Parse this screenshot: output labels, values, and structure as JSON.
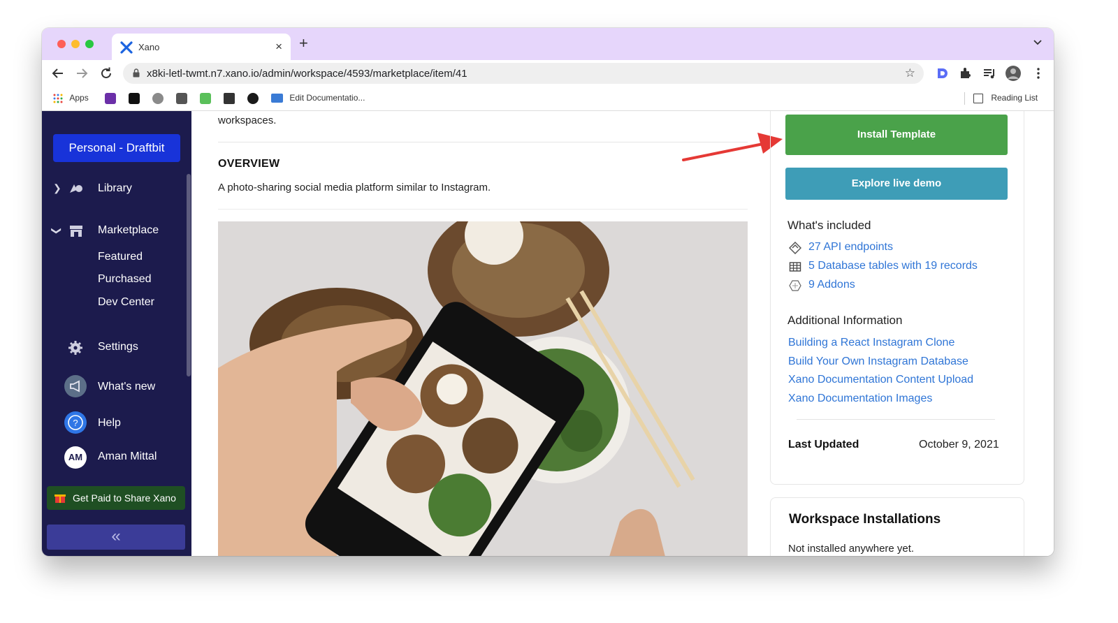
{
  "browser": {
    "tab_title": "Xano",
    "new_tab_glyph": "+",
    "close_glyph": "×",
    "url": "x8ki-letl-twmt.n7.xano.io/admin/workspace/4593/marketplace/item/41",
    "bookmarks": {
      "apps_label": "Apps",
      "edit_doc_label": "Edit Documentatio...",
      "reading_list_label": "Reading List"
    },
    "icons": [
      "back-icon",
      "forward-icon",
      "reload-icon",
      "lock-icon",
      "star-icon",
      "extension-icon",
      "puzzle-icon",
      "media-icon",
      "profile-icon",
      "menu-icon"
    ]
  },
  "sidebar": {
    "workspace_label": "Personal - Draftbit",
    "library_label": "Library",
    "marketplace_label": "Marketplace",
    "marketplace_items": [
      "Featured",
      "Purchased",
      "Dev Center"
    ],
    "settings_label": "Settings",
    "whats_new_label": "What's new",
    "help_label": "Help",
    "user_initials": "AM",
    "user_name": "Aman Mittal",
    "promo_label": "Get Paid to Share Xano",
    "collapse_glyph": "«"
  },
  "main": {
    "intro_end": "workspaces.",
    "overview_heading": "OVERVIEW",
    "overview_text": "A photo-sharing social media platform similar to Instagram."
  },
  "panel": {
    "install_label": "Install Template",
    "demo_label": "Explore live demo",
    "included_heading": "What's included",
    "included": [
      {
        "icon": "api-icon",
        "text": "27 API endpoints"
      },
      {
        "icon": "table-icon",
        "text": "5 Database tables with 19 records"
      },
      {
        "icon": "addon-icon",
        "text": "9 Addons"
      }
    ],
    "info_heading": "Additional Information",
    "info_links": [
      "Building a React Instagram Clone",
      "Build Your Own Instagram Database",
      "Xano Documentation Content Upload",
      "Xano Documentation Images"
    ],
    "last_updated_label": "Last Updated",
    "last_updated_value": "October 9, 2021",
    "installations_heading": "Workspace Installations",
    "installations_text": "Not installed anywhere yet."
  },
  "colors": {
    "tab_strip": "#e6d6fb",
    "sidebar_bg": "#1c1b4d",
    "workspace_btn": "#1833d9",
    "install_btn": "#4aa24a",
    "demo_btn": "#3e9db7",
    "link": "#2f75d6",
    "arrow": "#e53935"
  }
}
